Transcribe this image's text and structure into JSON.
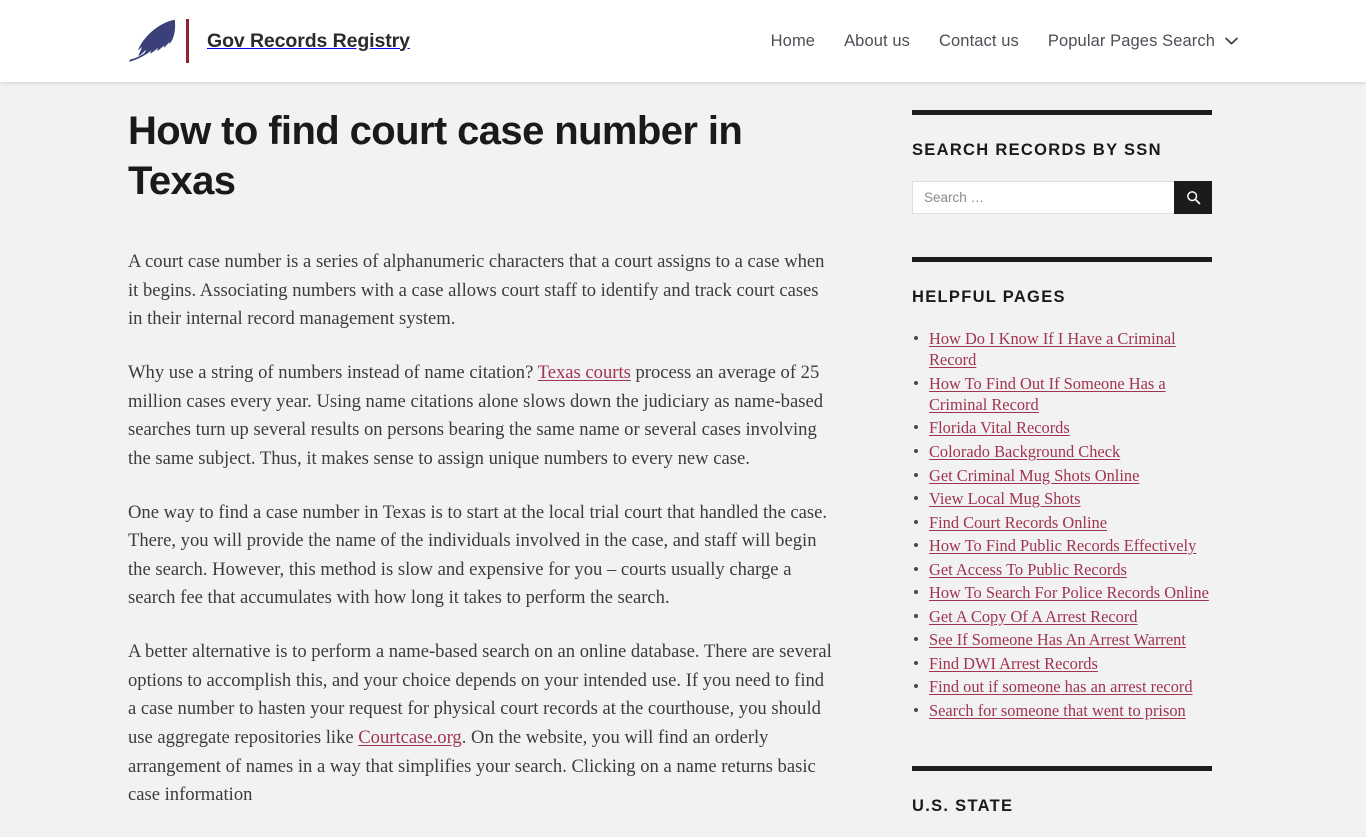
{
  "header": {
    "brand_name": "Gov Records Registry",
    "logo_icon": "quill-feather-icon",
    "nav": [
      {
        "label": "Home",
        "icon": null
      },
      {
        "label": "About us",
        "icon": null
      },
      {
        "label": "Contact us",
        "icon": null
      },
      {
        "label": "Popular Pages Search",
        "icon": "chevron-down-icon"
      }
    ]
  },
  "article": {
    "title": "How to find court case number in Texas",
    "paragraphs": [
      {
        "segments": [
          {
            "type": "text",
            "text": "A court case number is a series of alphanumeric characters that a court assigns to a case when it begins. Associating numbers with a case allows court staff to identify and track court cases in their internal record management system."
          }
        ]
      },
      {
        "segments": [
          {
            "type": "text",
            "text": "Why use a string of numbers instead of name citation? "
          },
          {
            "type": "link",
            "text": "Texas courts"
          },
          {
            "type": "text",
            "text": " process an average of 25 million cases every year. Using name citations alone slows down the judiciary as name-based searches turn up several results on persons bearing the same name or several cases involving the same subject. Thus, it makes sense to assign unique numbers to every new case."
          }
        ]
      },
      {
        "segments": [
          {
            "type": "text",
            "text": "One way to find a case number in Texas is to start at the local trial court that handled the case. There, you will provide the name of the individuals involved in the case, and staff will begin the search. However, this method is slow and expensive for you – courts usually charge a search fee that accumulates with how long it takes to perform the search."
          }
        ]
      },
      {
        "segments": [
          {
            "type": "text",
            "text": "A better alternative is to perform a name-based search on an online database. There are several options to accomplish this, and your choice depends on your intended use. If you need to find a case number to hasten your request for physical court records at the courthouse, you should use aggregate repositories like "
          },
          {
            "type": "link",
            "text": "Courtcase.org"
          },
          {
            "type": "text",
            "text": ". On the website, you will find an orderly arrangement of names in a way that simplifies your search. Clicking on a name returns basic case information"
          }
        ]
      }
    ]
  },
  "sidebar": {
    "search_widget": {
      "title": "SEARCH RECORDS BY SSN",
      "input_value": "",
      "placeholder": "Search …",
      "submit_icon": "search-icon"
    },
    "helpful_pages": {
      "title": "HELPFUL PAGES",
      "links": [
        "How Do I Know If I Have a Criminal Record",
        "How To Find Out If Someone Has a Criminal Record",
        "Florida Vital Records",
        "Colorado Background Check",
        "Get Criminal Mug Shots Online",
        "View Local Mug Shots",
        "Find Court Records Online",
        "How To Find Public Records Effectively",
        "Get Access To Public Records",
        "How To Search For Police Records Online",
        "Get A Copy Of A Arrest Record",
        "See If Someone Has An Arrest Warrent",
        "Find DWI Arrest Records",
        "Find out if someone has an arrest record",
        "Search for someone that went to prison"
      ]
    },
    "us_state_widget": {
      "title": "U.S. STATE"
    }
  },
  "colors": {
    "link": "#a03552",
    "brand_divider": "#8f2233",
    "logo": "#3b4078",
    "rule": "#1d1d1d",
    "page_background": "#f2f2f2",
    "header_background": "#ffffff"
  }
}
